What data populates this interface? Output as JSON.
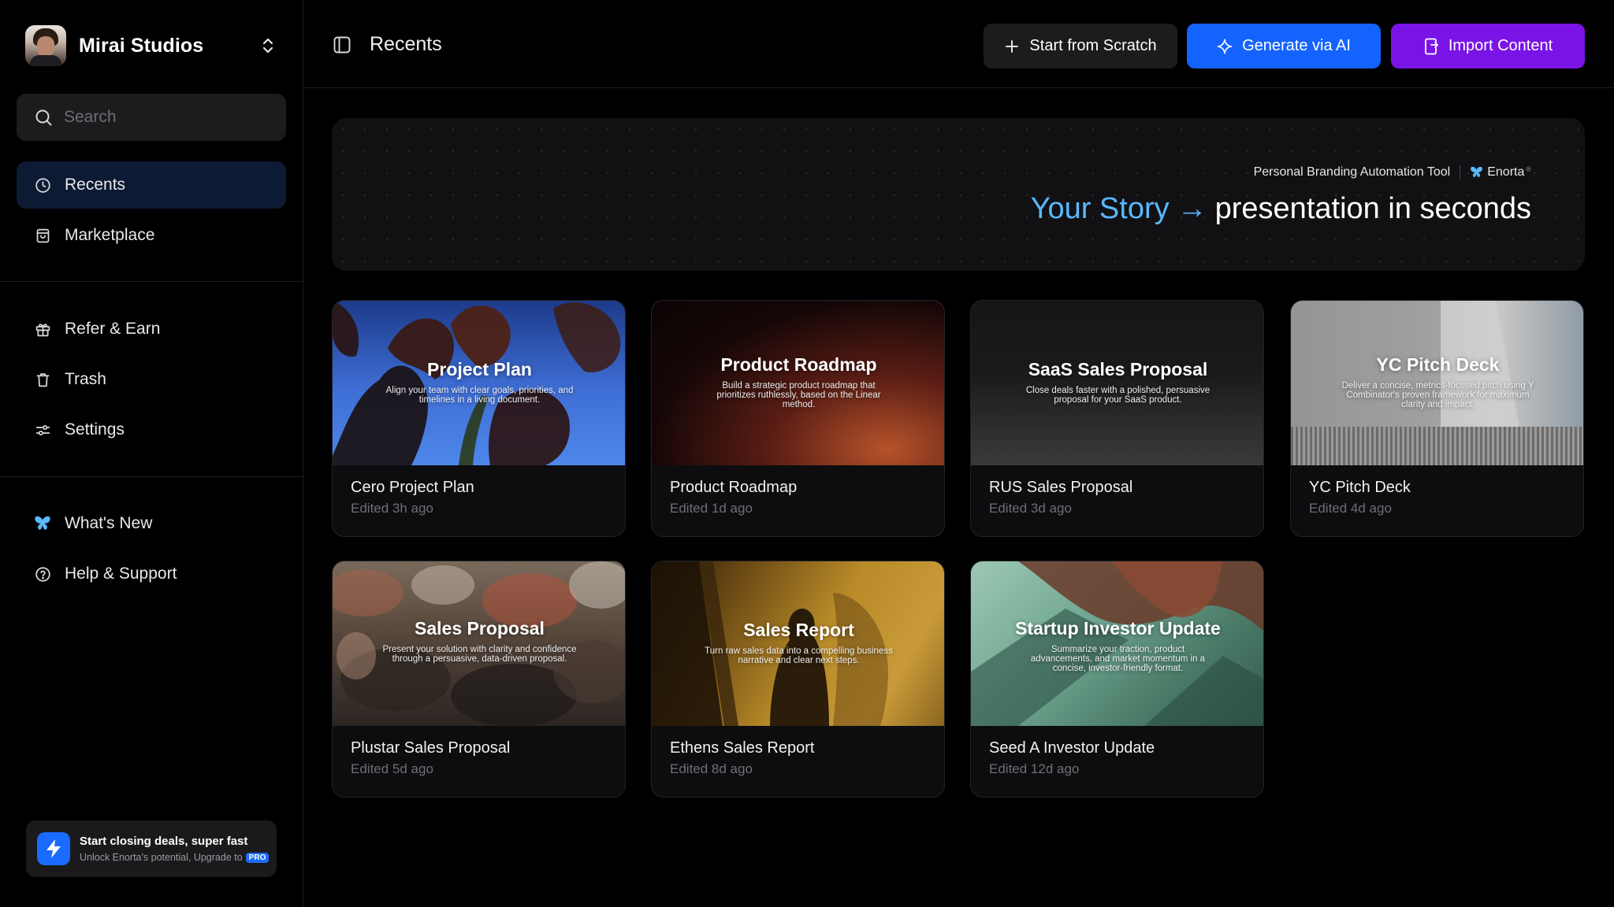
{
  "workspace": {
    "name": "Mirai Studios"
  },
  "search": {
    "placeholder": "Search"
  },
  "sidebar": {
    "primary": [
      {
        "label": "Recents",
        "icon": "clock-icon",
        "active": true
      },
      {
        "label": "Marketplace",
        "icon": "shopping-bag-icon",
        "active": false
      }
    ],
    "secondary": [
      {
        "label": "Refer & Earn",
        "icon": "gift-icon"
      },
      {
        "label": "Trash",
        "icon": "trash-icon"
      },
      {
        "label": "Settings",
        "icon": "sliders-icon"
      }
    ],
    "tertiary": [
      {
        "label": "What's New",
        "icon": "butterfly-icon"
      },
      {
        "label": "Help & Support",
        "icon": "help-circle-icon"
      }
    ]
  },
  "promo": {
    "title": "Start closing deals, super fast",
    "subtitle": "Unlock Enorta's potential, Upgrade to",
    "badge": "PRO"
  },
  "header": {
    "title": "Recents",
    "buttons": {
      "scratch": "Start from Scratch",
      "ai": "Generate via AI",
      "import": "Import Content"
    }
  },
  "banner": {
    "tagline": "Personal Branding Automation Tool",
    "brand": "Enorta",
    "brand_mark": "®",
    "headline_accent": "Your Story",
    "headline_arrow": "→",
    "headline_rest": "presentation in seconds"
  },
  "cards": [
    {
      "thumb_title": "Project Plan",
      "thumb_desc": "Align your team with clear goals, priorities, and timelines in a living document.",
      "name": "Cero Project Plan",
      "edited": "Edited 3h ago"
    },
    {
      "thumb_title": "Product Roadmap",
      "thumb_desc": "Build a strategic product roadmap that prioritizes ruthlessly, based on the Linear method.",
      "name": "Product Roadmap",
      "edited": "Edited 1d ago"
    },
    {
      "thumb_title": "SaaS Sales Proposal",
      "thumb_desc": "Close deals faster with a polished, persuasive proposal for your SaaS product.",
      "name": "RUS Sales Proposal",
      "edited": "Edited 3d ago"
    },
    {
      "thumb_title": "YC Pitch Deck",
      "thumb_desc": "Deliver a concise, metrics-focused pitch using Y Combinator's proven framework for maximum clarity and impact.",
      "name": "YC Pitch Deck",
      "edited": "Edited 4d ago"
    },
    {
      "thumb_title": "Sales Proposal",
      "thumb_desc": "Present your solution with clarity and confidence through a persuasive, data-driven proposal.",
      "name": "Plustar Sales Proposal",
      "edited": "Edited 5d ago"
    },
    {
      "thumb_title": "Sales Report",
      "thumb_desc": "Turn raw sales data into a compelling business narrative and clear next steps.",
      "name": "Ethens Sales Report",
      "edited": "Edited 8d ago"
    },
    {
      "thumb_title": "Startup Investor Update",
      "thumb_desc": "Summarize your traction, product advancements, and market momentum in a concise, investor-friendly format.",
      "name": "Seed A Investor Update",
      "edited": "Edited 12d ago"
    }
  ],
  "colors": {
    "accent_blue": "#1463ff",
    "accent_purple": "#7a14e6",
    "headline_blue": "#5ab8ff",
    "active_nav": "#0d1a33"
  }
}
